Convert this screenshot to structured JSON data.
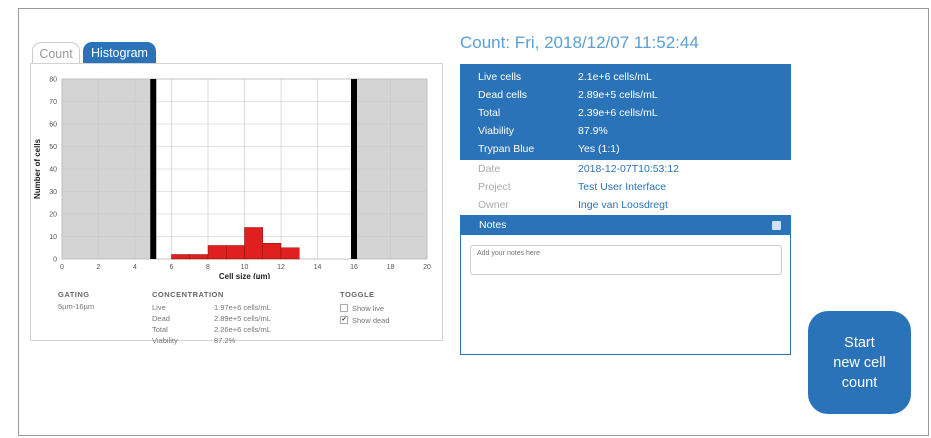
{
  "tabs": {
    "count": "Count",
    "histogram": "Histogram"
  },
  "title": "Count: Fri, 2018/12/07 11:52:44",
  "stats": [
    {
      "label": "Live cells",
      "value": "2.1e+6 cells/mL"
    },
    {
      "label": "Dead cells",
      "value": "2.89e+5 cells/mL"
    },
    {
      "label": "Total",
      "value": "2.39e+6 cells/mL"
    },
    {
      "label": "Viability",
      "value": "87.9%"
    },
    {
      "label": "Trypan Blue",
      "value": "Yes (1:1)"
    }
  ],
  "meta": [
    {
      "label": "Date",
      "value": "2018-12-07T10:53:12"
    },
    {
      "label": "Project",
      "value": "Test User Interface"
    },
    {
      "label": "Owner",
      "value": "Inge van Loosdregt"
    }
  ],
  "notes": {
    "title": "Notes",
    "placeholder": "Add your notes here"
  },
  "start_button": {
    "label": "Start\nnew cell\ncount"
  },
  "gating": {
    "header": "GATING",
    "value": "5µm-16µm"
  },
  "concentration": {
    "header": "CONCENTRATION",
    "rows": [
      {
        "label": "Live",
        "value": "1.97e+6 cells/mL"
      },
      {
        "label": "Dead",
        "value": "2.89e+5 cells/mL"
      },
      {
        "label": "Total",
        "value": "2.26e+6 cells/mL"
      },
      {
        "label": "Viability",
        "value": "87.2%"
      }
    ]
  },
  "toggle": {
    "header": "TOGGLE",
    "items": [
      {
        "label": "Show live",
        "checked": false
      },
      {
        "label": "Show dead",
        "checked": true
      }
    ]
  },
  "colors": {
    "accent": "#2b73b8",
    "bar": "#e01f1f",
    "gated_region": "#d4d4d4"
  },
  "chart_data": {
    "type": "bar",
    "xlabel": "Cell size (µm)",
    "ylabel": "Number of cells",
    "xlim": [
      0,
      20
    ],
    "ylim": [
      0,
      80
    ],
    "x_ticks": [
      0,
      2,
      4,
      6,
      8,
      10,
      12,
      14,
      16,
      18,
      20
    ],
    "y_ticks": [
      0,
      10,
      20,
      30,
      40,
      50,
      60,
      70,
      80
    ],
    "bins": [
      {
        "start": 6,
        "end": 7,
        "value": 2
      },
      {
        "start": 7,
        "end": 8,
        "value": 2
      },
      {
        "start": 8,
        "end": 9,
        "value": 6
      },
      {
        "start": 9,
        "end": 10,
        "value": 6
      },
      {
        "start": 10,
        "end": 11,
        "value": 14
      },
      {
        "start": 11,
        "end": 12,
        "value": 7
      },
      {
        "start": 12,
        "end": 13,
        "value": 5
      }
    ],
    "gates": [
      5,
      16
    ]
  }
}
